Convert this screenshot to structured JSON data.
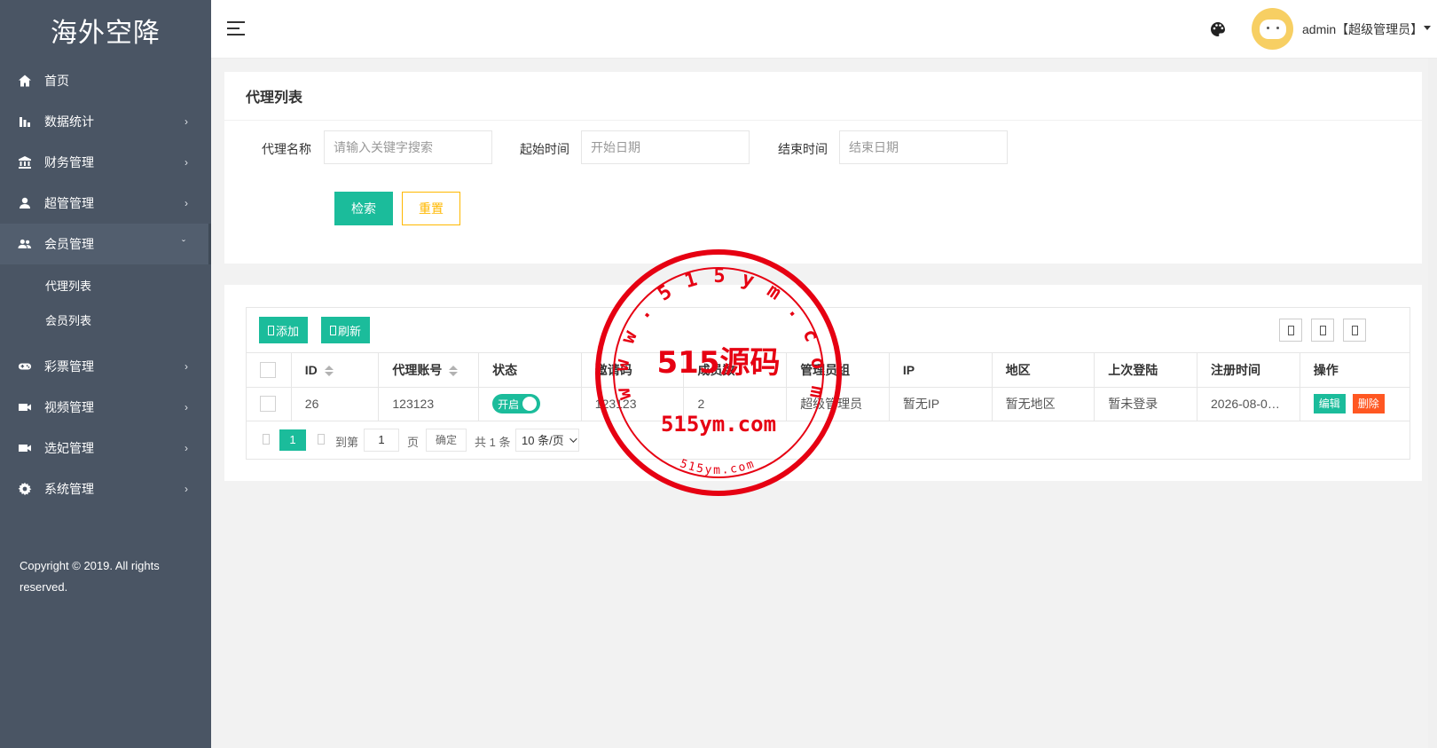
{
  "app": {
    "logo_text": "海外空降"
  },
  "sidebar": {
    "items": [
      {
        "label": "首页",
        "icon": "home-icon",
        "has_arrow": false
      },
      {
        "label": "数据统计",
        "icon": "bar-chart-icon",
        "has_arrow": true
      },
      {
        "label": "财务管理",
        "icon": "bank-icon",
        "has_arrow": true
      },
      {
        "label": "超管管理",
        "icon": "user-icon",
        "has_arrow": true
      },
      {
        "label": "会员管理",
        "icon": "users-icon",
        "has_arrow": true,
        "expanded": true
      },
      {
        "label": "彩票管理",
        "icon": "gamepad-icon",
        "has_arrow": true
      },
      {
        "label": "视频管理",
        "icon": "video-icon",
        "has_arrow": true
      },
      {
        "label": "选妃管理",
        "icon": "video-icon",
        "has_arrow": true
      },
      {
        "label": "系统管理",
        "icon": "gear-icon",
        "has_arrow": true
      }
    ],
    "sub_items": [
      "代理列表",
      "会员列表"
    ],
    "copyright": "Copyright © 2019. All rights reserved."
  },
  "header": {
    "user_label": "admin【超级管理员】"
  },
  "search": {
    "title": "代理列表",
    "agent_name_label": "代理名称",
    "agent_name_placeholder": "请输入关键字搜索",
    "start_label": "起始时间",
    "start_placeholder": "开始日期",
    "end_label": "结束时间",
    "end_placeholder": "结束日期",
    "search_button": "检索",
    "reset_button": "重置"
  },
  "table": {
    "add_button": "添加",
    "refresh_button": "刷新",
    "columns": [
      "ID",
      "代理账号",
      "状态",
      "邀请码",
      "成员数",
      "管理员组",
      "IP",
      "地区",
      "上次登陆",
      "注册时间",
      "操作"
    ],
    "rows": [
      {
        "id": "26",
        "account": "123123",
        "status": "开启",
        "invite_code": "123123",
        "members": "2",
        "admin_group": "超级管理员",
        "ip": "暂无IP",
        "region": "暂无地区",
        "last_login": "暂未登录",
        "register_time": "2026-08-0…",
        "edit_label": "编辑",
        "delete_label": "删除"
      }
    ]
  },
  "pager": {
    "current_page": "1",
    "goto_label": "到第",
    "goto_value": "1",
    "page_unit": "页",
    "confirm_button": "确定",
    "total_text": "共 1 条",
    "page_size": "10 条/页"
  },
  "watermark": {
    "ring_text": "w w w . 5 1 5 y m . c o m",
    "center_text": "515源码",
    "domain_text": "515ym.com",
    "bottom_text": "515ym.com"
  },
  "colors": {
    "sidebar_bg": "#4a5564",
    "accent": "#1bbc9b",
    "warning": "#ffb800",
    "danger": "#ff5722",
    "stamp_red": "#e60012"
  }
}
